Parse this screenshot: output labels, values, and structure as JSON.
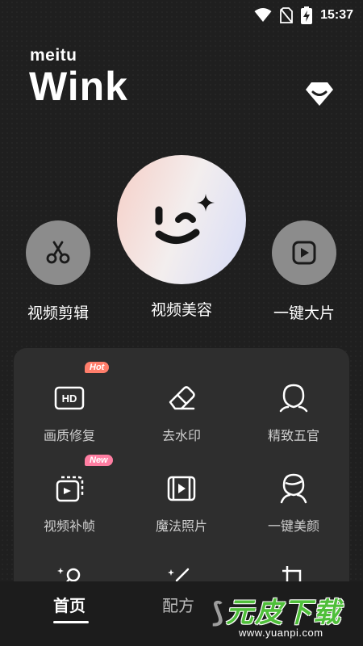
{
  "status_bar": {
    "time": "15:37"
  },
  "brand": {
    "sub": "meitu",
    "main": "Wink"
  },
  "features": [
    {
      "label": "视频剪辑",
      "icon": "scissors-icon"
    },
    {
      "label": "视频美容",
      "icon": "wink-face-icon"
    },
    {
      "label": "一键大片",
      "icon": "play-square-icon"
    }
  ],
  "tools": [
    {
      "label": "画质修复",
      "icon": "hd-icon",
      "badge": "Hot"
    },
    {
      "label": "去水印",
      "icon": "eraser-icon"
    },
    {
      "label": "精致五官",
      "icon": "face-outline-icon"
    },
    {
      "label": "视频补帧",
      "icon": "frames-icon",
      "badge": "New"
    },
    {
      "label": "魔法照片",
      "icon": "film-play-icon"
    },
    {
      "label": "一键美颜",
      "icon": "portrait-icon"
    }
  ],
  "bottom_nav": {
    "home": "首页",
    "formula": "配方"
  },
  "watermark": {
    "title": "元皮下载",
    "url": "www.yuanpi.com"
  },
  "colors": {
    "background": "#1f1f1f",
    "panel": "#2e2e2e",
    "hot_badge": "#ff7e6b",
    "new_badge": "#ff7ea2"
  }
}
